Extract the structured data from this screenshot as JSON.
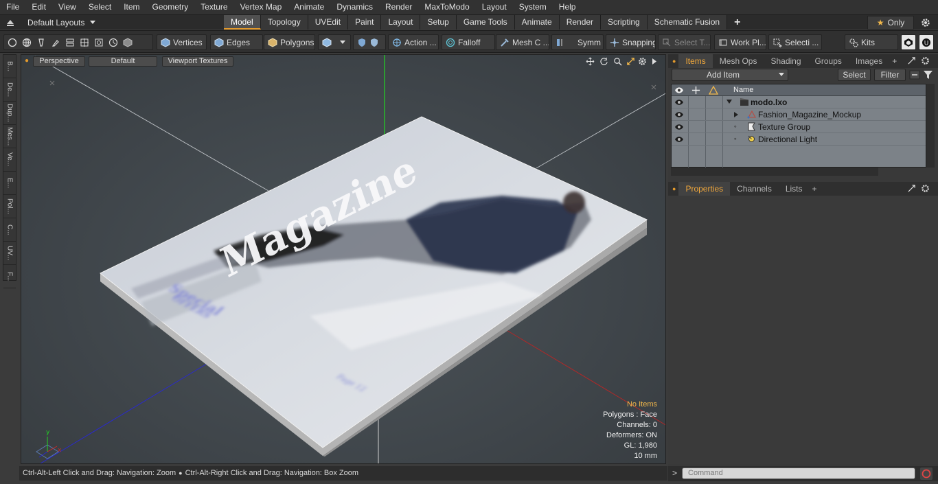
{
  "menu": [
    "File",
    "Edit",
    "View",
    "Select",
    "Item",
    "Geometry",
    "Texture",
    "Vertex Map",
    "Animate",
    "Dynamics",
    "Render",
    "MaxToModo",
    "Layout",
    "System",
    "Help"
  ],
  "layout_bar": {
    "layout_dropdown": "Default Layouts",
    "tabs": [
      "Model",
      "Topology",
      "UVEdit",
      "Paint",
      "Layout",
      "Setup",
      "Game Tools",
      "Animate",
      "Render",
      "Scripting",
      "Schematic Fusion"
    ],
    "active_tab": "Model",
    "only_label": "Only"
  },
  "toolbar": {
    "vertices": "Vertices",
    "edges": "Edges",
    "polygons": "Polygons",
    "action": "Action ...",
    "falloff": "Falloff",
    "mesh": "Mesh C ...",
    "symm": "Symm ...",
    "snapping": "Snapping",
    "select_t": "Select T...",
    "work_plane": "Work Pl...",
    "selection": "Selecti ...",
    "kits": "Kits"
  },
  "left_tabs": [
    "B...",
    "De...",
    "Dup...",
    "Mes...",
    "Ve...",
    "E...",
    "Pol...",
    "C...",
    "UV...",
    "F..."
  ],
  "viewport": {
    "view_mode": "Perspective",
    "shading": "Default",
    "textures": "Viewport Textures",
    "magazine_title": "Magazine",
    "cover_special": "Special",
    "cover_offers": "OFFERS",
    "cover_page": "Page 12",
    "info": {
      "no_items": "No Items",
      "polygons": "Polygons : Face",
      "channels": "Channels: 0",
      "deformers": "Deformers: ON",
      "gl": "GL: 1,980",
      "units": "10 mm"
    }
  },
  "status": {
    "zoom_hint": "Ctrl-Alt-Left Click and Drag: Navigation: Zoom",
    "box_zoom_hint": "Ctrl-Alt-Right Click and Drag: Navigation: Box Zoom"
  },
  "items_panel": {
    "tabs": [
      "Items",
      "Mesh Ops",
      "Shading",
      "Groups",
      "Images"
    ],
    "active_tab": "Items",
    "add_item": "Add Item",
    "select": "Select",
    "filter": "Filter",
    "column_name": "Name",
    "tree": [
      {
        "label": "modo.lxo",
        "depth": 0,
        "bold": true
      },
      {
        "label": "Fashion_Magazine_Mockup",
        "depth": 1,
        "bold": false
      },
      {
        "label": "Texture Group",
        "depth": 1,
        "bold": false
      },
      {
        "label": "Directional Light",
        "depth": 1,
        "bold": false
      }
    ]
  },
  "properties_panel": {
    "tabs": [
      "Properties",
      "Channels",
      "Lists"
    ],
    "active_tab": "Properties"
  },
  "command": {
    "placeholder": "Command"
  },
  "colors": {
    "accent": "#e39a2c",
    "active_tab_text": "#f2a83b",
    "warning": "#f2b84b"
  }
}
